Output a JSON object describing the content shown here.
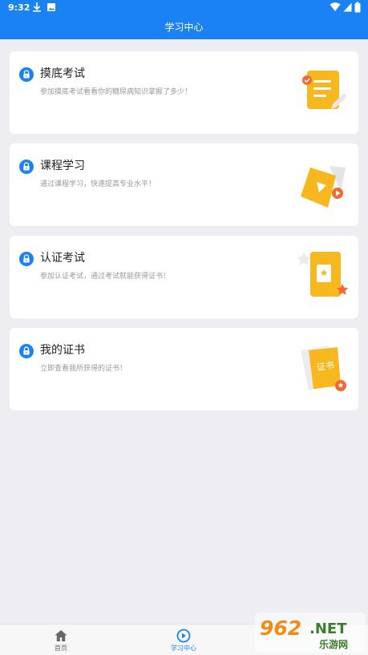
{
  "status_bar": {
    "time": "9:32"
  },
  "header": {
    "title": "学习中心"
  },
  "cards": [
    {
      "title": "摸底考试",
      "desc": "参加摸底考试看看你的糖尿病知识掌握了多少！"
    },
    {
      "title": "课程学习",
      "desc": "通过课程学习，快速提高专业水平！"
    },
    {
      "title": "认证考试",
      "desc": "参加认证考试，通过考试就能获得证书！"
    },
    {
      "title": "我的证书",
      "desc": "立即查看我所获得的证书！",
      "badge": "证书"
    }
  ],
  "tabs": [
    {
      "label": "首页"
    },
    {
      "label": "学习中心"
    }
  ],
  "watermark": {
    "brand": "962",
    "suffix": ".NET",
    "cn": "乐游网"
  },
  "colors": {
    "primary": "#1b82f5",
    "accent": "#f6b81e",
    "orange": "#f06a35"
  }
}
